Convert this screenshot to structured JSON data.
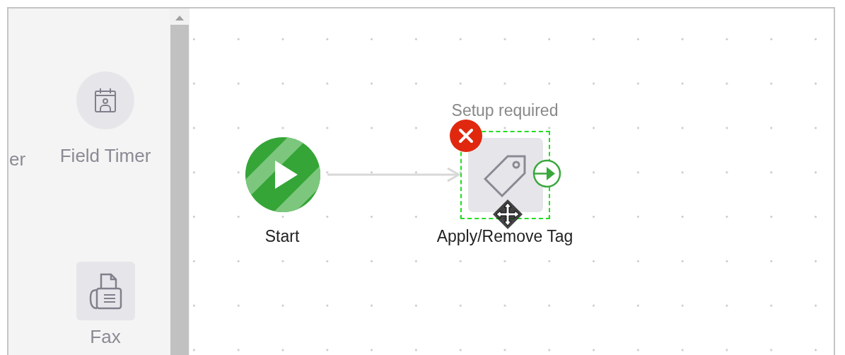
{
  "palette": {
    "items": [
      {
        "label": "er",
        "kind": "text"
      },
      {
        "label": "Field Timer",
        "kind": "timer"
      },
      {
        "label": "Fax",
        "kind": "fax"
      }
    ]
  },
  "canvas": {
    "nodes": [
      {
        "kind": "start",
        "label": "Start"
      },
      {
        "kind": "action",
        "label": "Apply/Remove Tag",
        "status": "Setup required",
        "error": true,
        "selected": true
      }
    ]
  }
}
